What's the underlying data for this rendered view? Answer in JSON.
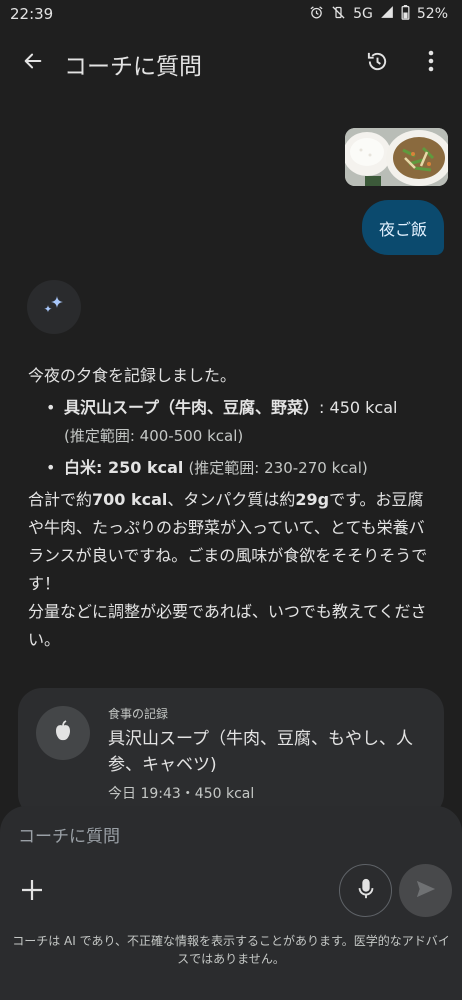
{
  "status_bar": {
    "time": "22:39",
    "network": "5G",
    "battery": "52%",
    "icons": [
      "alarm-icon",
      "vibrate-off-icon",
      "signal-icon",
      "battery-icon"
    ]
  },
  "app_bar": {
    "title": "コーチに質問",
    "back_icon": "arrow-back-icon",
    "history_icon": "history-icon",
    "more_icon": "more-vert-icon"
  },
  "user_message": {
    "photo": "meal-photo",
    "text": "夜ご飯"
  },
  "assistant": {
    "avatar_icon": "sparkle-icon",
    "intro": "今夜の夕食を記録しました。",
    "bullets": [
      {
        "item": "具沢山スープ（牛肉、豆腐、野菜）",
        "kcal": ": 450 kcal",
        "range": "(推定範囲: 400-500 kcal)"
      },
      {
        "item": "白米",
        "kcal": ": 250 kcal",
        "range": "(推定範囲: 230-270 kcal)"
      }
    ],
    "summary_prefix": "合計で約",
    "summary_kcal": "700 kcal",
    "summary_mid": "、タンパク質は約",
    "summary_protein": "29g",
    "summary_rest": "です。お豆腐や牛肉、たっぷりのお野菜が入っていて、とても栄養バランスが良いですね。ごまの風味が食欲をそそりそうです！",
    "closing": "分量などに調整が必要であれば、いつでも教えてください。"
  },
  "meal_card": {
    "icon": "apple-icon",
    "kicker": "食事の記録",
    "title": "具沢山スープ（牛肉、豆腐、もやし、人参、キャベツ)",
    "meta": "今日 19:43・450 kcal"
  },
  "composer": {
    "placeholder": "コーチに質問",
    "value": "",
    "plus_icon": "plus-icon",
    "mic_icon": "mic-icon",
    "send_icon": "send-icon",
    "disclaimer": "コーチは AI であり、不正確な情報を表示することがあります。医学的なアドバイスではありません。"
  },
  "colors": {
    "background": "#1f1f1f",
    "user_bubble": "#0b4a6e",
    "card": "#2c2d2f"
  }
}
